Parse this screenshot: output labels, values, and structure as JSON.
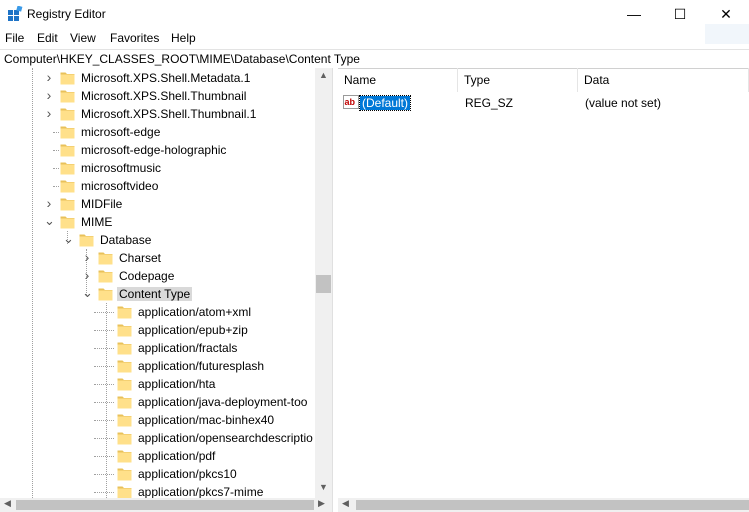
{
  "window": {
    "title": "Registry Editor",
    "minimize": "—",
    "maximize": "☐",
    "close": "✕"
  },
  "menu": [
    "File",
    "Edit",
    "View",
    "Favorites",
    "Help"
  ],
  "address": "Computer\\HKEY_CLASSES_ROOT\\MIME\\Database\\Content Type",
  "tree": {
    "items": [
      {
        "label": "Microsoft.XPS.Shell.Metadata.1",
        "expander": "collapsed"
      },
      {
        "label": "Microsoft.XPS.Shell.Thumbnail",
        "expander": "collapsed"
      },
      {
        "label": "Microsoft.XPS.Shell.Thumbnail.1",
        "expander": "collapsed"
      },
      {
        "label": "microsoft-edge",
        "expander": "none"
      },
      {
        "label": "microsoft-edge-holographic",
        "expander": "none"
      },
      {
        "label": "microsoftmusic",
        "expander": "none"
      },
      {
        "label": "microsoftvideo",
        "expander": "none"
      },
      {
        "label": "MIDFile",
        "expander": "collapsed"
      },
      {
        "label": "MIME",
        "expander": "expanded"
      },
      {
        "label": "Database",
        "expander": "expanded"
      },
      {
        "label": "Charset",
        "expander": "collapsed"
      },
      {
        "label": "Codepage",
        "expander": "collapsed"
      },
      {
        "label": "Content Type",
        "expander": "expanded",
        "selected": true
      },
      {
        "label": "application/atom+xml",
        "expander": "none"
      },
      {
        "label": "application/epub+zip",
        "expander": "none"
      },
      {
        "label": "application/fractals",
        "expander": "none"
      },
      {
        "label": "application/futuresplash",
        "expander": "none"
      },
      {
        "label": "application/hta",
        "expander": "none"
      },
      {
        "label": "application/java-deployment-too",
        "expander": "none"
      },
      {
        "label": "application/mac-binhex40",
        "expander": "none"
      },
      {
        "label": "application/opensearchdescriptio",
        "expander": "none"
      },
      {
        "label": "application/pdf",
        "expander": "none"
      },
      {
        "label": "application/pkcs10",
        "expander": "none"
      },
      {
        "label": "application/pkcs7-mime",
        "expander": "none"
      }
    ]
  },
  "list": {
    "columns": [
      "Name",
      "Type",
      "Data"
    ],
    "rows": [
      {
        "name": "(Default)",
        "type": "REG_SZ",
        "data": "(value not set)",
        "icon": "string-value-icon"
      }
    ]
  },
  "colors": {
    "selection": "#0078d7",
    "folder": "#ffe08a",
    "scrollbar": "#f0f0f0"
  }
}
